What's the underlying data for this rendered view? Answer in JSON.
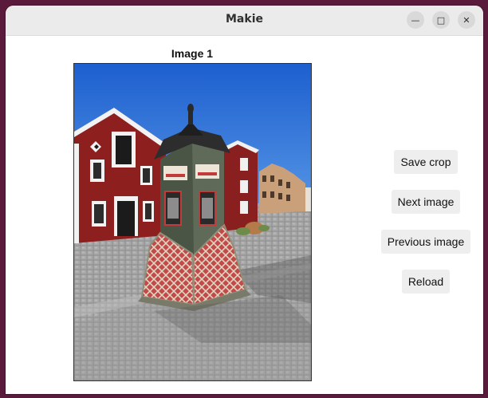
{
  "window": {
    "title": "Makie",
    "minimize_icon": "minimize-icon",
    "maximize_icon": "maximize-icon",
    "close_icon": "close-icon"
  },
  "image_panel": {
    "title": "Image 1"
  },
  "buttons": {
    "save_crop": "Save crop",
    "next_image": "Next image",
    "previous_image": "Previous image",
    "reload": "Reload"
  },
  "colors": {
    "desktop_bg": "#5a1a3c",
    "titlebar_bg": "#ebebeb",
    "button_bg": "#eeeeee"
  }
}
